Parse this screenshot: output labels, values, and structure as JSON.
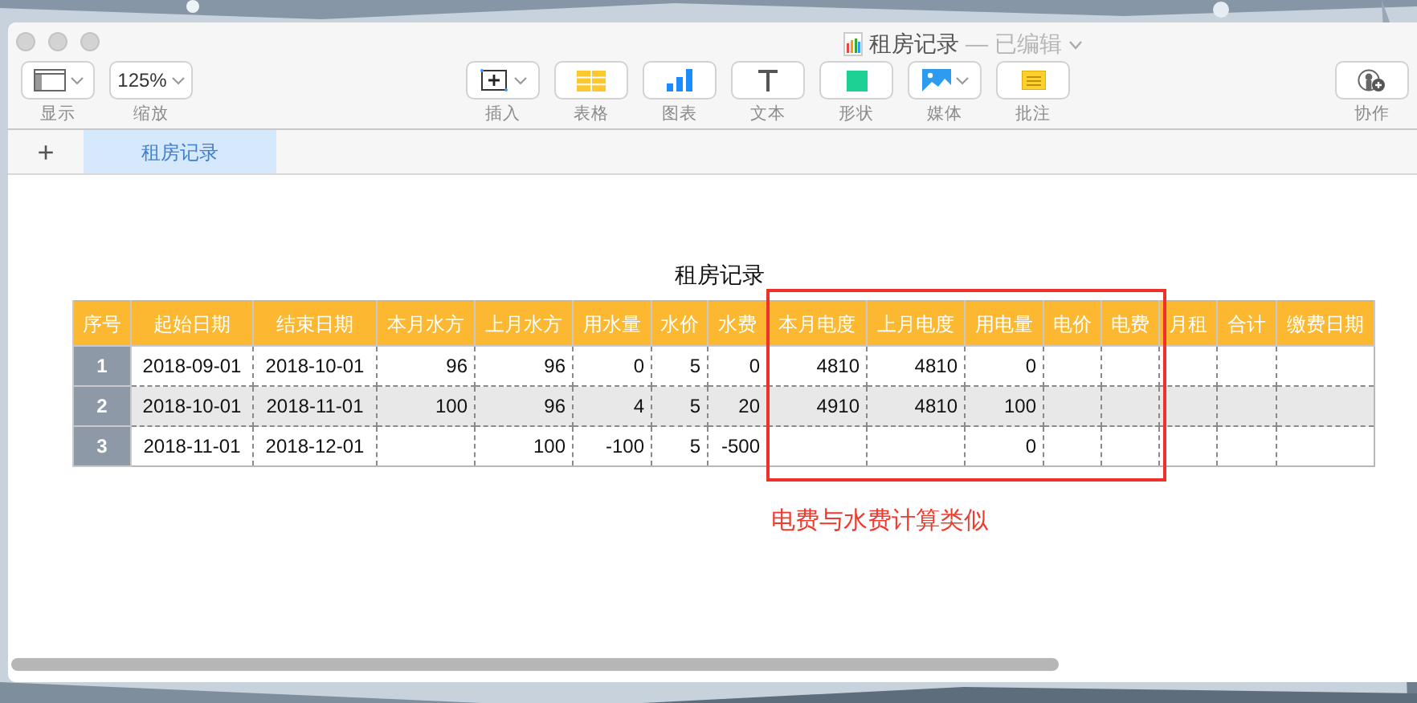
{
  "window": {
    "title": "租房记录",
    "status": "— 已编辑"
  },
  "toolbar": [
    {
      "kind": "view",
      "label": "显示"
    },
    {
      "kind": "zoom",
      "label": "缩放",
      "value": "125%"
    },
    {
      "kind": "insert",
      "label": "插入"
    },
    {
      "kind": "table",
      "label": "表格"
    },
    {
      "kind": "chart",
      "label": "图表"
    },
    {
      "kind": "text",
      "label": "文本"
    },
    {
      "kind": "shape",
      "label": "形状"
    },
    {
      "kind": "media",
      "label": "媒体"
    },
    {
      "kind": "comment",
      "label": "批注"
    },
    {
      "kind": "collaborate",
      "label": "协作"
    }
  ],
  "sheet_tabs": {
    "add": "+",
    "tabs": [
      {
        "label": "租房记录",
        "selected": true
      }
    ]
  },
  "table": {
    "title": "租房记录",
    "columns": [
      "序号",
      "起始日期",
      "结束日期",
      "本月水方",
      "上月水方",
      "用水量",
      "水价",
      "水费",
      "本月电度",
      "上月电度",
      "用电量",
      "电价",
      "电费",
      "月租",
      "合计",
      "缴费日期"
    ],
    "rows": [
      {
        "shaded": false,
        "cells": [
          "1",
          "2018-09-01",
          "2018-10-01",
          "96",
          "96",
          "0",
          "5",
          "0",
          "4810",
          "4810",
          "0",
          null,
          null,
          null,
          null,
          null
        ]
      },
      {
        "shaded": true,
        "cells": [
          "2",
          "2018-10-01",
          "2018-11-01",
          "100",
          "96",
          "4",
          "5",
          "20",
          "4910",
          "4810",
          "100",
          null,
          null,
          null,
          null,
          null
        ]
      },
      {
        "shaded": false,
        "cells": [
          "3",
          "2018-11-01",
          "2018-12-01",
          null,
          "100",
          "-100",
          "5",
          "-500",
          null,
          null,
          "0",
          null,
          null,
          null,
          null,
          null
        ]
      }
    ]
  },
  "annotation": {
    "text": "电费与水费计算类似"
  }
}
